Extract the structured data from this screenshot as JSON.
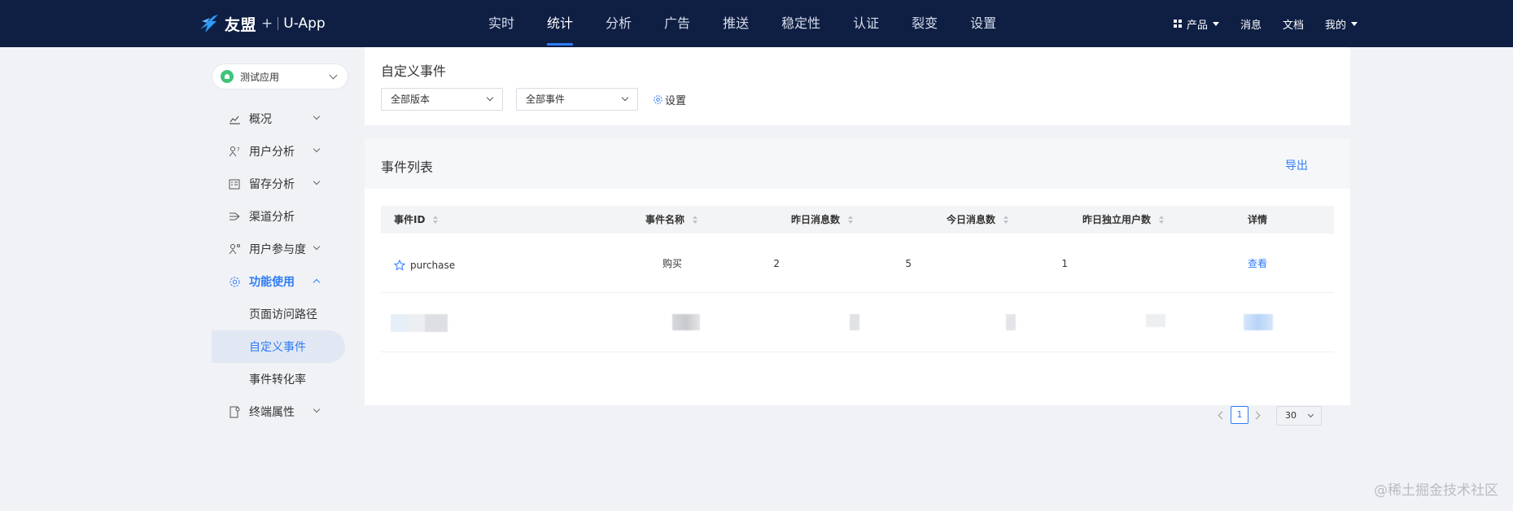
{
  "header": {
    "brand": "友盟",
    "plus": "+",
    "app": "U-App",
    "nav": [
      {
        "label": "实时",
        "active": false
      },
      {
        "label": "统计",
        "active": true
      },
      {
        "label": "分析",
        "active": false
      },
      {
        "label": "广告",
        "active": false
      },
      {
        "label": "推送",
        "active": false
      },
      {
        "label": "稳定性",
        "active": false
      },
      {
        "label": "认证",
        "active": false
      },
      {
        "label": "裂变",
        "active": false
      },
      {
        "label": "设置",
        "active": false
      }
    ],
    "right": {
      "products": "产品",
      "messages": "消息",
      "docs": "文档",
      "mine": "我的"
    }
  },
  "sidebar": {
    "app_select": "测试应用",
    "items": [
      {
        "label": "概况",
        "icon": "chart-line-icon"
      },
      {
        "label": "用户分析",
        "icon": "user-analysis-icon"
      },
      {
        "label": "留存分析",
        "icon": "retention-icon"
      },
      {
        "label": "渠道分析",
        "icon": "channel-icon"
      },
      {
        "label": "用户参与度",
        "icon": "engagement-icon"
      },
      {
        "label": "功能使用",
        "icon": "gear-icon"
      }
    ],
    "sub_items": [
      {
        "label": "页面访问路径",
        "active": false
      },
      {
        "label": "自定义事件",
        "active": true
      },
      {
        "label": "事件转化率",
        "active": false
      }
    ],
    "last_item": {
      "label": "终端属性",
      "icon": "device-icon"
    }
  },
  "main": {
    "title": "自定义事件",
    "version_select": "全部版本",
    "event_select": "全部事件",
    "settings": "设置",
    "list_title": "事件列表",
    "export": "导出",
    "columns": [
      "事件ID",
      "事件名称",
      "昨日消息数",
      "今日消息数",
      "昨日独立用户数",
      "详情"
    ],
    "rows": [
      {
        "id": "purchase",
        "name": "购买",
        "yesterday": "2",
        "today": "5",
        "uv": "1",
        "detail": "查看"
      }
    ],
    "pagination": {
      "page": "1",
      "size": "30"
    }
  },
  "watermark": "@稀土掘金技术社区",
  "colors": {
    "topbar": "#0f1f44",
    "accent": "#2f7cf6",
    "background": "#f0f2f5"
  }
}
